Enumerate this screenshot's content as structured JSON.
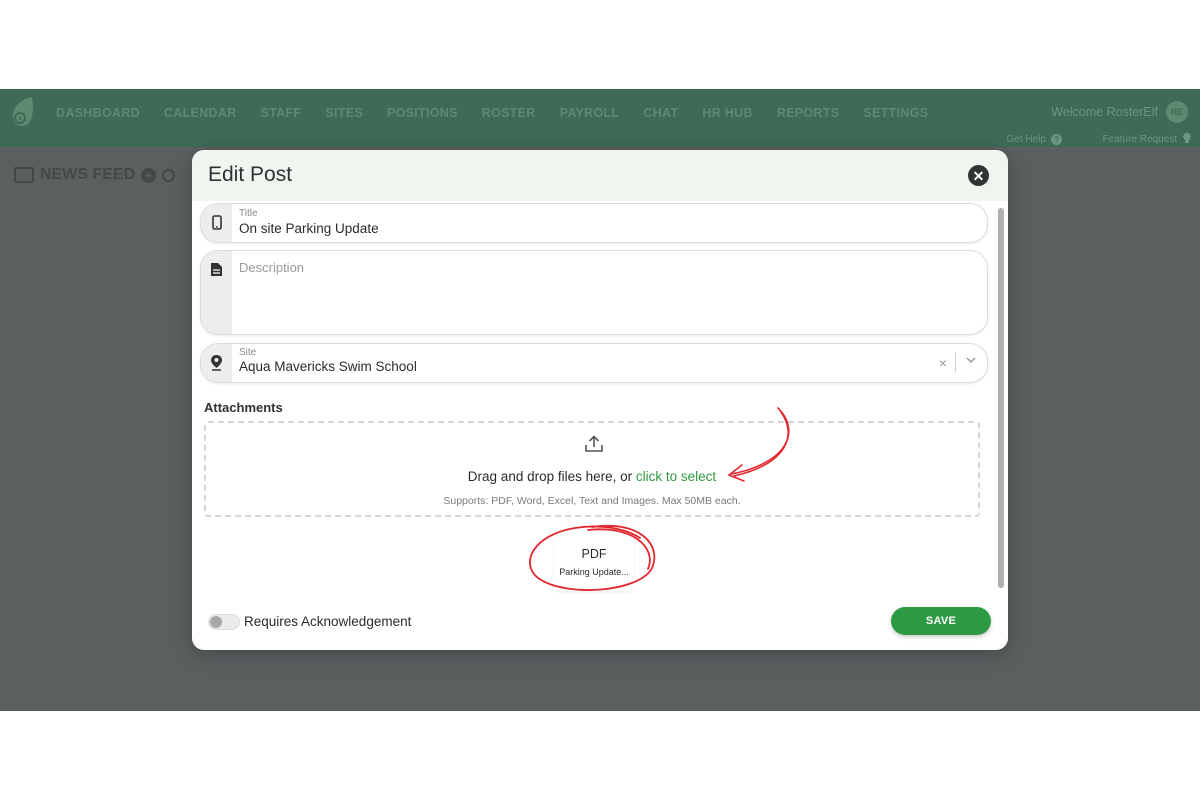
{
  "nav": {
    "items": [
      "DASHBOARD",
      "CALENDAR",
      "STAFF",
      "SITES",
      "POSITIONS",
      "ROSTER",
      "PAYROLL",
      "CHAT",
      "HR HUB",
      "REPORTS",
      "SETTINGS"
    ],
    "welcome": "Welcome RosterElf",
    "avatar_initials": "RE",
    "get_help": "Get Help",
    "feature_request": "Feature Request"
  },
  "page": {
    "title": "NEWS FEED"
  },
  "modal": {
    "title": "Edit Post",
    "title_field": {
      "label": "Title",
      "value": "On site Parking Update"
    },
    "description_field": {
      "placeholder": "Description"
    },
    "site_field": {
      "label": "Site",
      "value": "Aqua Mavericks Swim School",
      "clear": "×"
    },
    "attachments": {
      "label": "Attachments",
      "drop_text": "Drag and drop files here, or",
      "drop_link": "click to select",
      "supports": "Supports: PDF, Word, Excel, Text and Images. Max 50MB each."
    },
    "file": {
      "type": "PDF",
      "name": "Parking Update..."
    },
    "ack_label": "Requires Acknowledgement",
    "ack_enabled": false,
    "save_label": "SAVE"
  },
  "colors": {
    "accent_green": "#2e9a43",
    "nav_bg": "#3f6a55",
    "annotation_red": "#e0282e"
  },
  "icons": {
    "close": "close-icon",
    "phone": "phone-icon",
    "document": "document-icon",
    "location": "location-pin-icon",
    "upload": "upload-icon",
    "chevron": "chevron-down-icon"
  }
}
